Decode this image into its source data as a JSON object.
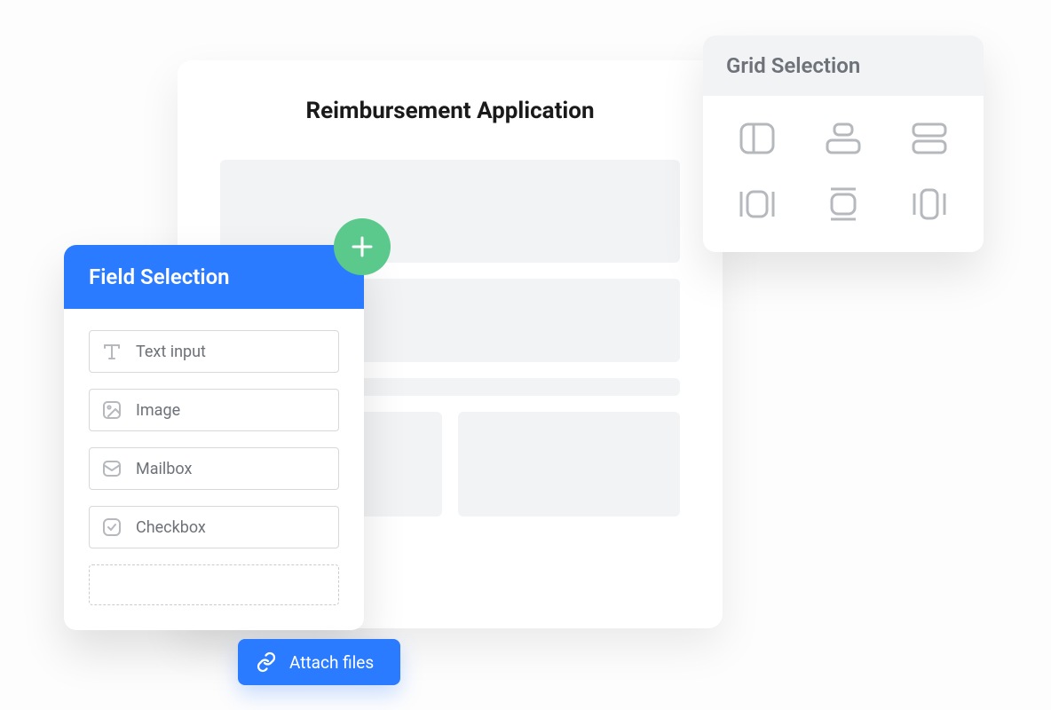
{
  "form": {
    "title": "Reimbursement Application"
  },
  "fieldPanel": {
    "title": "Field Selection",
    "items": [
      {
        "label": "Text input"
      },
      {
        "label": "Image"
      },
      {
        "label": "Mailbox"
      },
      {
        "label": "Checkbox"
      }
    ]
  },
  "attach": {
    "label": "Attach files"
  },
  "gridPanel": {
    "title": "Grid Selection"
  }
}
